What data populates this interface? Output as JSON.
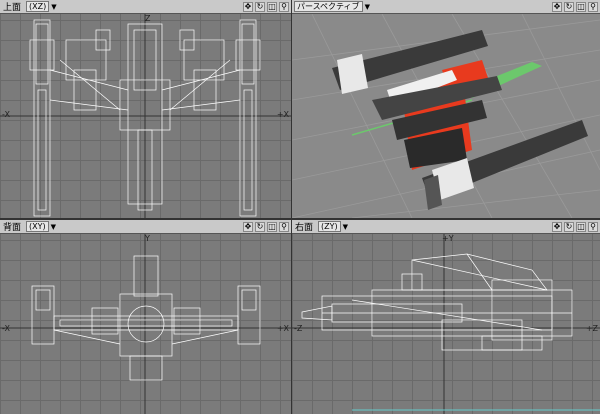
{
  "viewports": [
    {
      "id": "top",
      "title": "上面",
      "axis": "(XZ)",
      "axis_labels": {
        "left": "-X",
        "right": "+X",
        "top": "Z"
      }
    },
    {
      "id": "perspective",
      "title": "パースペクティブ",
      "axis": "",
      "axis_labels": {}
    },
    {
      "id": "back",
      "title": "背面",
      "axis": "(XY)",
      "axis_labels": {
        "left": "-X",
        "right": "+X",
        "top": "Y"
      }
    },
    {
      "id": "right",
      "title": "右面",
      "axis": "(ZY)",
      "axis_labels": {
        "left": "-Z",
        "right": "+Z",
        "top": "+Y"
      }
    }
  ],
  "icons": [
    "pan-icon",
    "rotate-icon",
    "zoom-icon",
    "magnify-icon"
  ],
  "colors": {
    "header": "#c9c9c9",
    "grid": "#7b7b7b",
    "wire": "#ffffff",
    "red": "#e83a1e",
    "green": "#6cc86c"
  }
}
